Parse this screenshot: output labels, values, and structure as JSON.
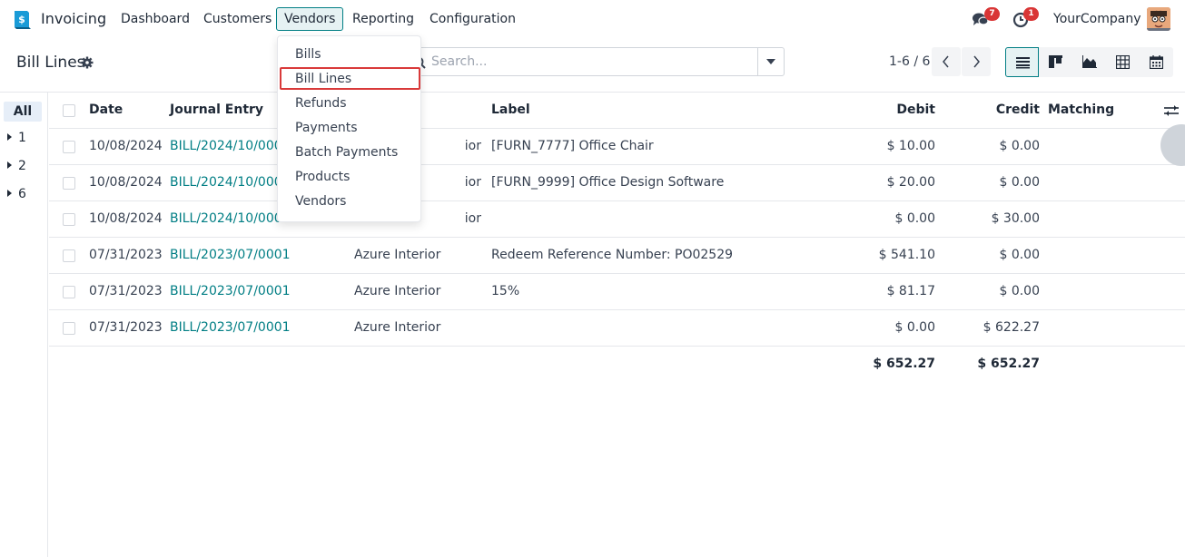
{
  "navbar": {
    "app_name": "Invoicing",
    "menu": [
      {
        "label": "Dashboard"
      },
      {
        "label": "Customers"
      },
      {
        "label": "Vendors"
      },
      {
        "label": "Reporting"
      },
      {
        "label": "Configuration"
      }
    ],
    "messages_badge": "7",
    "activities_badge": "1",
    "company": "YourCompany"
  },
  "control_panel": {
    "title": "Bill Lines",
    "search_placeholder": "Search...",
    "pager": "1-6 / 6"
  },
  "vendors_menu": {
    "items": [
      "Bills",
      "Bill Lines",
      "Refunds",
      "Payments",
      "Batch Payments",
      "Products",
      "Vendors"
    ],
    "highlighted": "Bill Lines"
  },
  "groups": {
    "all": "All",
    "items": [
      "1",
      "2",
      "6"
    ]
  },
  "table": {
    "columns": {
      "date": "Date",
      "journal_entry": "Journal Entry",
      "partner": "",
      "label": "Label",
      "debit": "Debit",
      "credit": "Credit",
      "matching": "Matching"
    },
    "rows": [
      {
        "date": "10/08/2024",
        "journal_entry": "BILL/2024/10/0001",
        "partner": "ior",
        "label": "[FURN_7777] Office Chair",
        "debit": "$ 10.00",
        "credit": "$ 0.00"
      },
      {
        "date": "10/08/2024",
        "journal_entry": "BILL/2024/10/0001",
        "partner": "ior",
        "label": "[FURN_9999] Office Design Software",
        "debit": "$ 20.00",
        "credit": "$ 0.00"
      },
      {
        "date": "10/08/2024",
        "journal_entry": "BILL/2024/10/0001",
        "partner": "ior",
        "label": "",
        "debit": "$ 0.00",
        "credit": "$ 30.00"
      },
      {
        "date": "07/31/2023",
        "journal_entry": "BILL/2023/07/0001",
        "partner": "Azure Interior",
        "label": "Redeem Reference Number: PO02529",
        "debit": "$ 541.10",
        "credit": "$ 0.00"
      },
      {
        "date": "07/31/2023",
        "journal_entry": "BILL/2023/07/0001",
        "partner": "Azure Interior",
        "label": "15%",
        "debit": "$ 81.17",
        "credit": "$ 0.00"
      },
      {
        "date": "07/31/2023",
        "journal_entry": "BILL/2023/07/0001",
        "partner": "Azure Interior",
        "label": "",
        "debit": "$ 0.00",
        "credit": "$ 622.27"
      }
    ],
    "totals": {
      "debit": "$ 652.27",
      "credit": "$ 652.27"
    }
  }
}
